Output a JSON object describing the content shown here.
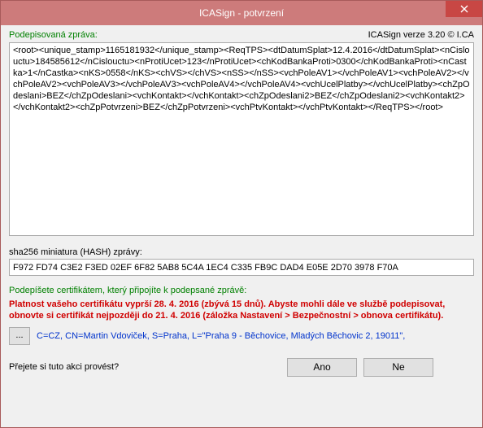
{
  "titlebar": {
    "title": "ICASign - potvrzení"
  },
  "header": {
    "signed_message_label": "Podepisovaná zpráva:",
    "version_text": "ICASign verze 3.20 © I.CA"
  },
  "message": {
    "content": "<root><unique_stamp>1165181932</unique_stamp><ReqTPS><dtDatumSplat>12.4.2016</dtDatumSplat><nCislouctu>184585612</nCislouctu><nProtiUcet>123</nProtiUcet><chKodBankaProti>0300</chKodBankaProti><nCastka>1</nCastka><nKS>0558</nKS><chVS></chVS><nSS></nSS><vchPoleAV1></vchPoleAV1><vchPoleAV2></vchPoleAV2><vchPoleAV3></vchPoleAV3><vchPoleAV4></vchPoleAV4><vchUcelPlatby></vchUcelPlatby><chZpOdeslani>BEZ</chZpOdeslani><vchKontakt></vchKontakt><chZpOdeslani2>BEZ</chZpOdeslani2><vchKontakt2></vchKontakt2><chZpPotvrzeni>BEZ</chZpPotvrzeni><vchPtvKontakt></vchPtvKontakt></ReqTPS></root>"
  },
  "hash": {
    "label": "sha256 miniatura (HASH) zprávy:",
    "value": "F972 FD74 C3E2 F3ED 02EF 6F82 5AB8 5C4A 1EC4 C335 FB9C DAD4 E05E 2D70 3978 F70A"
  },
  "sign": {
    "label": "Podepíšete certifikátem, který připojíte k podepsané zprávě:",
    "warning": "Platnost vašeho certifikátu vyprší 28. 4. 2016 (zbývá 15 dnů). Abyste mohli dále ve službě podepisovat, obnovte si certifikát nejpozději do 21. 4. 2016 (záložka Nastavení > Bezpečnostní > obnova certifikátu).",
    "ellipsis_label": "...",
    "certificate": "C=CZ, CN=Martin Vdoviček, S=Praha, L=\"Praha 9 - Běchovice, Mladých Běchovic 2, 19011\","
  },
  "confirm": {
    "question": "Přejete si tuto akci provést?",
    "yes": "Ano",
    "no": "Ne"
  }
}
